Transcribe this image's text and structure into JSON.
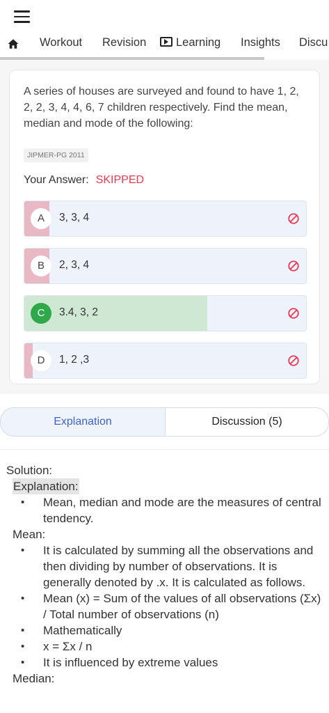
{
  "nav": {
    "tabs": [
      {
        "label": "Workout"
      },
      {
        "label": "Revision"
      },
      {
        "label": "Learning"
      },
      {
        "label": "Insights"
      },
      {
        "label": "Discu"
      }
    ]
  },
  "question": {
    "text": "A series of houses are surveyed and found to have 1, 2, 2, 2, 3, 4, 4, 6, 7 children respectively. Find the mean, median and mode of the following:",
    "tag": "JIPMER-PG 2011",
    "answer_label": "Your Answer:",
    "answer_value": "SKIPPED",
    "options": [
      {
        "letter": "A",
        "text": "3, 3, 4",
        "fill_fraction": 0.09,
        "fill_color": "#e8b9c4",
        "correct": false
      },
      {
        "letter": "B",
        "text": "2, 3, 4",
        "fill_fraction": 0.09,
        "fill_color": "#e8b9c4",
        "correct": false
      },
      {
        "letter": "C",
        "text": "3.4, 3, 2",
        "fill_fraction": 0.65,
        "fill_color": "#cfe8d3",
        "correct": true
      },
      {
        "letter": "D",
        "text": "1, 2 ,3",
        "fill_fraction": 0.03,
        "fill_color": "#e8b9c4",
        "correct": false
      }
    ]
  },
  "segment": {
    "explanation_label": "Explanation",
    "discussion_label": "Discussion (5)"
  },
  "solution": {
    "title": "Solution:",
    "explanation_heading": "Explanation:",
    "explanation_items": [
      "Mean, median and mode are the measures of central tendency."
    ],
    "mean_heading": "Mean:",
    "mean_items": [
      "It is calculated by summing all the observations and then dividing by number of observations. It is generally denoted by .x. It is calculated as follows.",
      "Mean (x) = Sum of the values of all observations (Σx) / Total number of observations (n)",
      "Mathematically",
      "x = Σx / n",
      "It is influenced by extreme values"
    ],
    "median_heading": "Median:"
  },
  "colors": {
    "accent": "#3f63c4",
    "skipped": "#e53950",
    "correct": "#2ea84a",
    "wrong_icon": "#e53950"
  }
}
